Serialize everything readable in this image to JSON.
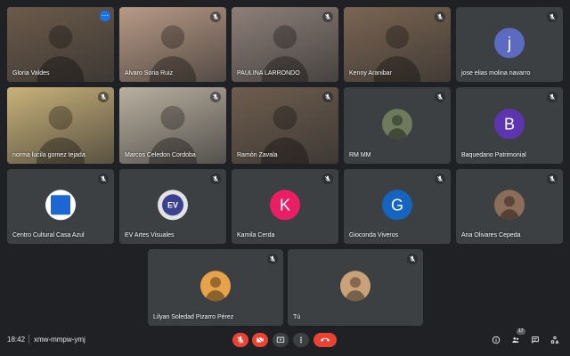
{
  "meeting": {
    "time": "18:42",
    "code": "xmw-mmpw-ymj",
    "participant_count": "17"
  },
  "tiles": [
    {
      "name": "Gloria Valdes",
      "type": "video",
      "muted": false,
      "menu": true,
      "active": true,
      "bg": "#6b5a4a"
    },
    {
      "name": "Alvaro Soria Ruiz",
      "type": "video",
      "muted": true,
      "bg": "#b89a86"
    },
    {
      "name": "PAULINA LARRONDO",
      "type": "video",
      "muted": true,
      "bg": "#8d7f78"
    },
    {
      "name": "Kenny Aranibar",
      "type": "video",
      "muted": true,
      "bg": "#7a6552"
    },
    {
      "name": "jose elias molina navarro",
      "type": "avatar",
      "muted": true,
      "letter": "j",
      "color": "#5c6bc0"
    },
    {
      "name": "norma lucila gomez tejada",
      "type": "video",
      "muted": true,
      "bg": "#c9b27a"
    },
    {
      "name": "Marcos Celedon Cordoba",
      "type": "video",
      "muted": true,
      "bg": "#b9b0a0"
    },
    {
      "name": "Ramón Zavala",
      "type": "video",
      "muted": true,
      "bg": "#6e5d4e"
    },
    {
      "name": "RM MM",
      "type": "photo",
      "muted": true,
      "color": "#6d7b5c"
    },
    {
      "name": "Baquedano Patrimonial",
      "type": "avatar",
      "muted": true,
      "letter": "B",
      "color": "#5e35b1"
    },
    {
      "name": "Centro Cultural Casa Azul",
      "type": "photo",
      "muted": true,
      "color": "#ffffff",
      "inner": "#1e66d6"
    },
    {
      "name": "EV Artes Visuales",
      "type": "photo",
      "muted": true,
      "color": "#e2e2e2",
      "inner": "#3a3f8f",
      "text": "EV"
    },
    {
      "name": "Kamila Cerda",
      "type": "avatar",
      "muted": true,
      "letter": "K",
      "color": "#e91e63"
    },
    {
      "name": "Gioconda Viveros",
      "type": "avatar",
      "muted": true,
      "letter": "G",
      "color": "#1565c0"
    },
    {
      "name": "Ana Olivares Cepeda",
      "type": "photo",
      "muted": true,
      "color": "#8c6d5a"
    },
    {
      "name": "Lilyan Soledad Pizarro Pérez",
      "type": "photo",
      "muted": true,
      "color": "#e8a24a"
    },
    {
      "name": "Tú",
      "type": "photo",
      "muted": true,
      "color": "#c9a27a"
    }
  ],
  "controls": {
    "mic": "mic-off",
    "camera": "camera-off",
    "present": "present-screen",
    "more": "more-options",
    "end": "end-call"
  },
  "right_controls": [
    "info",
    "people",
    "chat",
    "activities"
  ],
  "colors": {
    "accent": "#8ab4f8",
    "danger": "#ea4335",
    "tile_bg": "#3c4043",
    "page_bg": "#202124"
  }
}
